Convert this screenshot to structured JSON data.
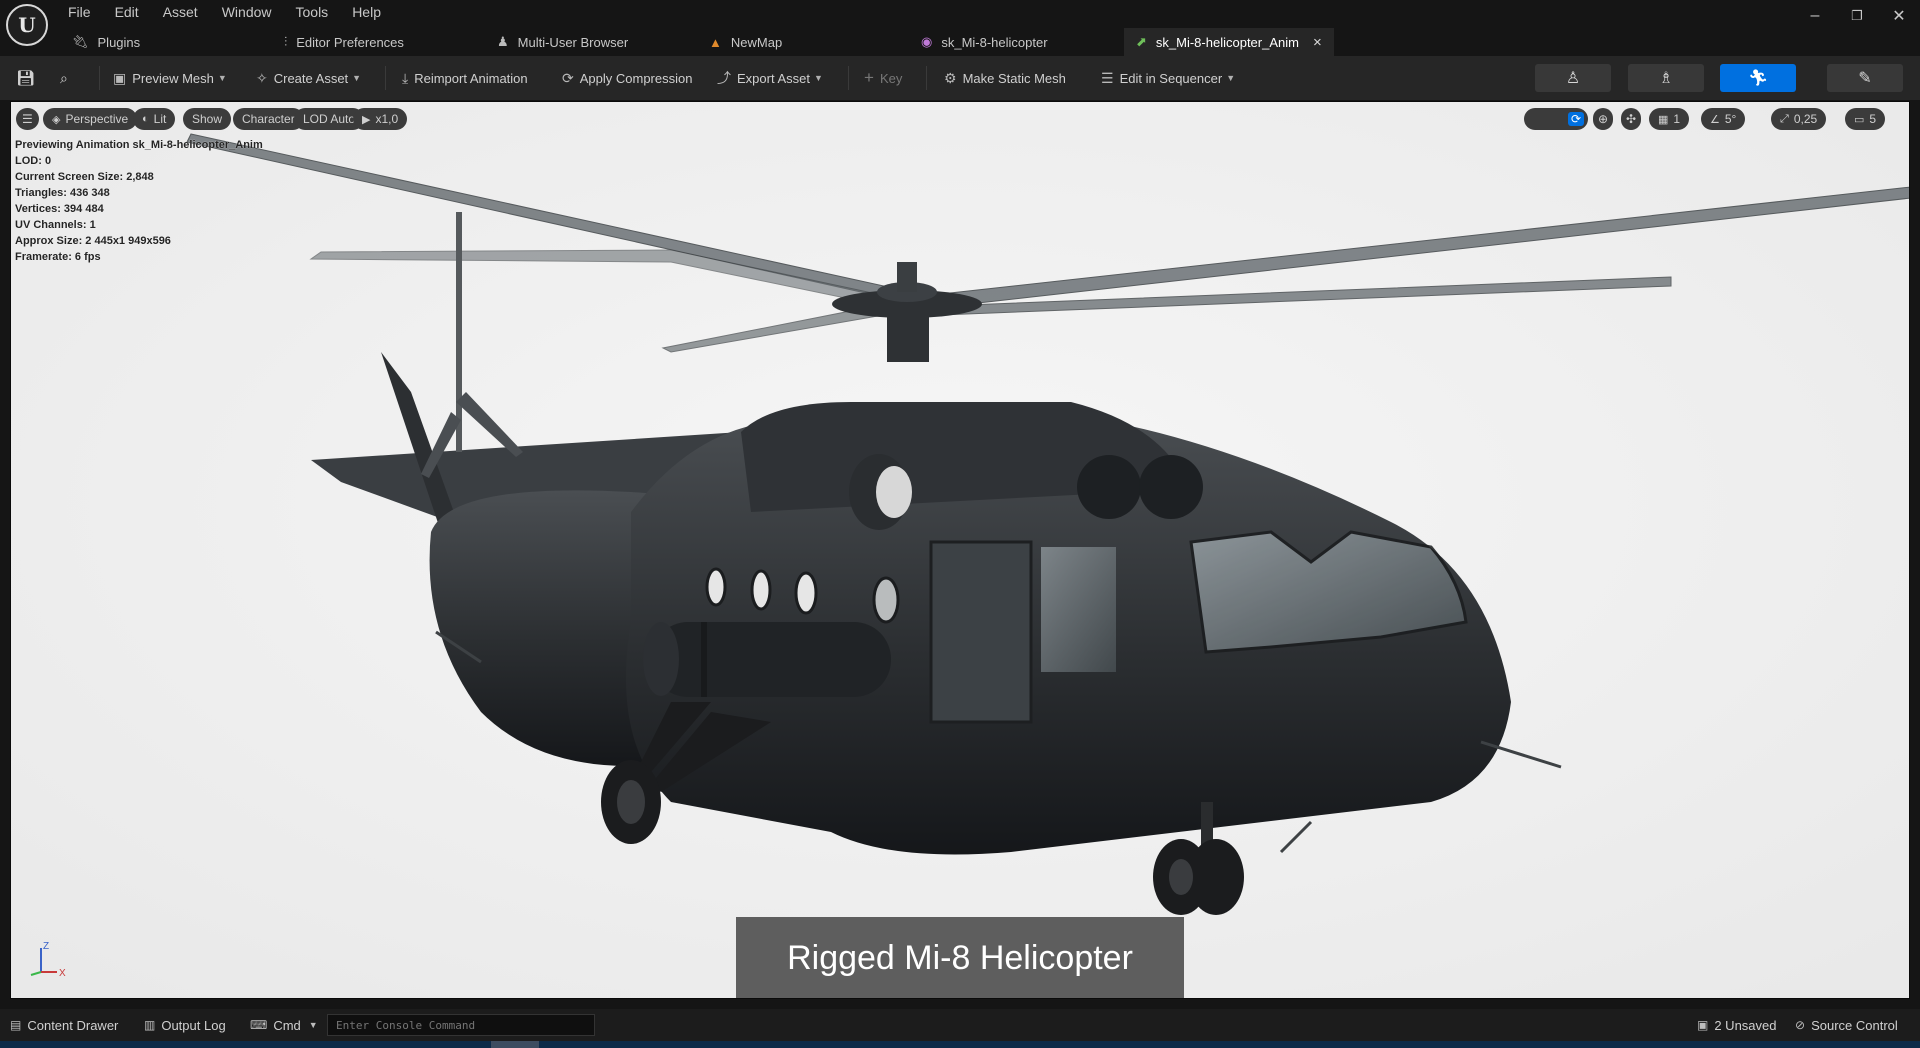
{
  "app": {
    "logo_letter": "U"
  },
  "menu": [
    "File",
    "Edit",
    "Asset",
    "Window",
    "Tools",
    "Help"
  ],
  "window_controls": {
    "minimize": "–",
    "restore": "❐",
    "close": "✕"
  },
  "tabs": [
    {
      "label": "Plugins",
      "icon": "plug-icon"
    },
    {
      "label": "Editor Preferences",
      "icon": "sliders-icon"
    },
    {
      "label": "Multi-User Browser",
      "icon": "users-icon"
    },
    {
      "label": "NewMap",
      "icon": "level-icon"
    },
    {
      "label": "sk_Mi-8-helicopter",
      "icon": "skeleton-icon"
    },
    {
      "label": "sk_Mi-8-helicopter_Anim",
      "icon": "animation-icon",
      "active": true
    }
  ],
  "toolbar": {
    "preview_mesh": "Preview Mesh",
    "create_asset": "Create Asset",
    "reimport_animation": "Reimport Animation",
    "apply_compression": "Apply Compression",
    "export_asset": "Export Asset",
    "key": "Key",
    "make_static_mesh": "Make Static Mesh",
    "edit_in_sequencer": "Edit in Sequencer"
  },
  "viewport": {
    "perspective": "Perspective",
    "lit": "Lit",
    "show": "Show",
    "character": "Character",
    "lod": "LOD Auto",
    "playback": "x1,0",
    "grid_snap": "1",
    "rotation_snap": "5°",
    "scale_snap": "0,25",
    "camera_speed": "5",
    "stats": {
      "previewing": "Previewing Animation sk_Mi-8-helicopter_Anim",
      "lod": "LOD: 0",
      "screen_size": "Current Screen Size: 2,848",
      "triangles": "Triangles: 436 348",
      "vertices": "Vertices: 394 484",
      "uv_channels": "UV Channels: 1",
      "approx_size": "Approx Size: 2 445x1 949x596",
      "framerate": "Framerate: 6 fps"
    },
    "caption": "Rigged Mi-8 Helicopter",
    "axis_z": "Z",
    "axis_x": "X"
  },
  "statusbar": {
    "content_drawer": "Content Drawer",
    "output_log": "Output Log",
    "cmd": "Cmd",
    "console_placeholder": "Enter Console Command",
    "unsaved": "2 Unsaved",
    "source_control": "Source Control"
  },
  "colors": {
    "accent": "#0070e0",
    "viewport_bg": "#f1f1f1",
    "panel": "#262626"
  }
}
